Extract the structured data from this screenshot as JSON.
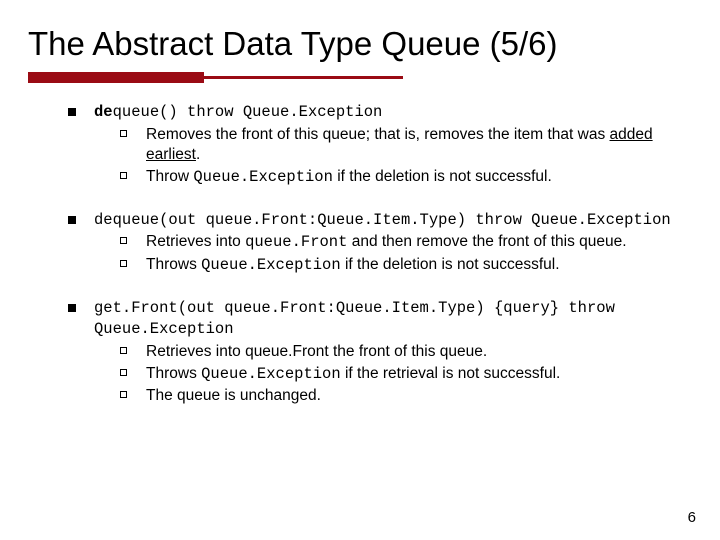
{
  "title": "The Abstract Data Type Queue (5/6)",
  "items": [
    {
      "sig_pre_bold": "de",
      "sig_post": "queue() throw Queue.Exception",
      "subs": [
        {
          "pre": "Removes the front of this queue; that is, removes the item that was ",
          "underlined": "added earliest",
          "post": "."
        },
        {
          "pre": "Throw ",
          "mono": "Queue.Exception",
          "post": " if the deletion is not successful."
        }
      ]
    },
    {
      "sig": "dequeue(out queue.Front:Queue.Item.Type) throw Queue.Exception",
      "subs": [
        {
          "pre": "Retrieves into ",
          "mono": "queue.Front",
          "post": " and then remove the front of this queue."
        },
        {
          "pre": "Throws ",
          "mono": "Queue.Exception",
          "post": " if the deletion is not successful."
        }
      ]
    },
    {
      "sig": "get.Front(out queue.Front:Queue.Item.Type) {query} throw Queue.Exception",
      "subs": [
        {
          "pre": "Retrieves into queue.Front the front of this queue."
        },
        {
          "pre": "Throws ",
          "mono": "Queue.Exception",
          "post": " if the retrieval is not successful."
        },
        {
          "pre": "The queue is unchanged."
        }
      ]
    }
  ],
  "pagenum": "6"
}
